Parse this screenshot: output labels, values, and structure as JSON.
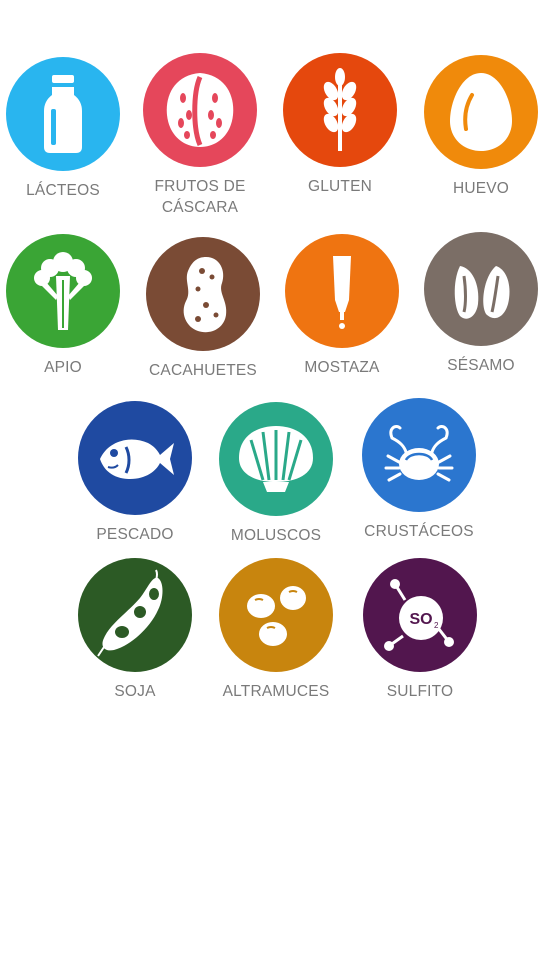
{
  "allergens": [
    {
      "key": "lacteos",
      "label": "LÁCTEOS",
      "color": "#29b5ef",
      "icon": "milk-bottle-icon"
    },
    {
      "key": "frutos",
      "label": "FRUTOS DE\nCÁSCARA",
      "color": "#e5475b",
      "icon": "nut-icon"
    },
    {
      "key": "gluten",
      "label": "GLUTEN",
      "color": "#e5480d",
      "icon": "wheat-icon"
    },
    {
      "key": "huevo",
      "label": "HUEVO",
      "color": "#f08a0b",
      "icon": "egg-icon"
    },
    {
      "key": "apio",
      "label": "APIO",
      "color": "#3aa535",
      "icon": "celery-icon"
    },
    {
      "key": "cacahuetes",
      "label": "CACAHUETES",
      "color": "#7a4b35",
      "icon": "peanut-icon"
    },
    {
      "key": "mostaza",
      "label": "MOSTAZA",
      "color": "#ef7411",
      "icon": "mustard-icon"
    },
    {
      "key": "sesamo",
      "label": "SÉSAMO",
      "color": "#7b6e66",
      "icon": "sesame-icon"
    },
    {
      "key": "pescado",
      "label": "PESCADO",
      "color": "#1f4aa1",
      "icon": "fish-icon"
    },
    {
      "key": "moluscos",
      "label": "MOLUSCOS",
      "color": "#2aa989",
      "icon": "shell-icon"
    },
    {
      "key": "crustaceos",
      "label": "CRUSTÁCEOS",
      "color": "#2b76cf",
      "icon": "crab-icon"
    },
    {
      "key": "soja",
      "label": "SOJA",
      "color": "#2c5a25",
      "icon": "soy-icon"
    },
    {
      "key": "altramuces",
      "label": "ALTRAMUCES",
      "color": "#c8850e",
      "icon": "lupin-icon"
    },
    {
      "key": "sulfito",
      "label": "SULFITO",
      "color": "#52164e",
      "icon": "sulfite-icon"
    }
  ]
}
